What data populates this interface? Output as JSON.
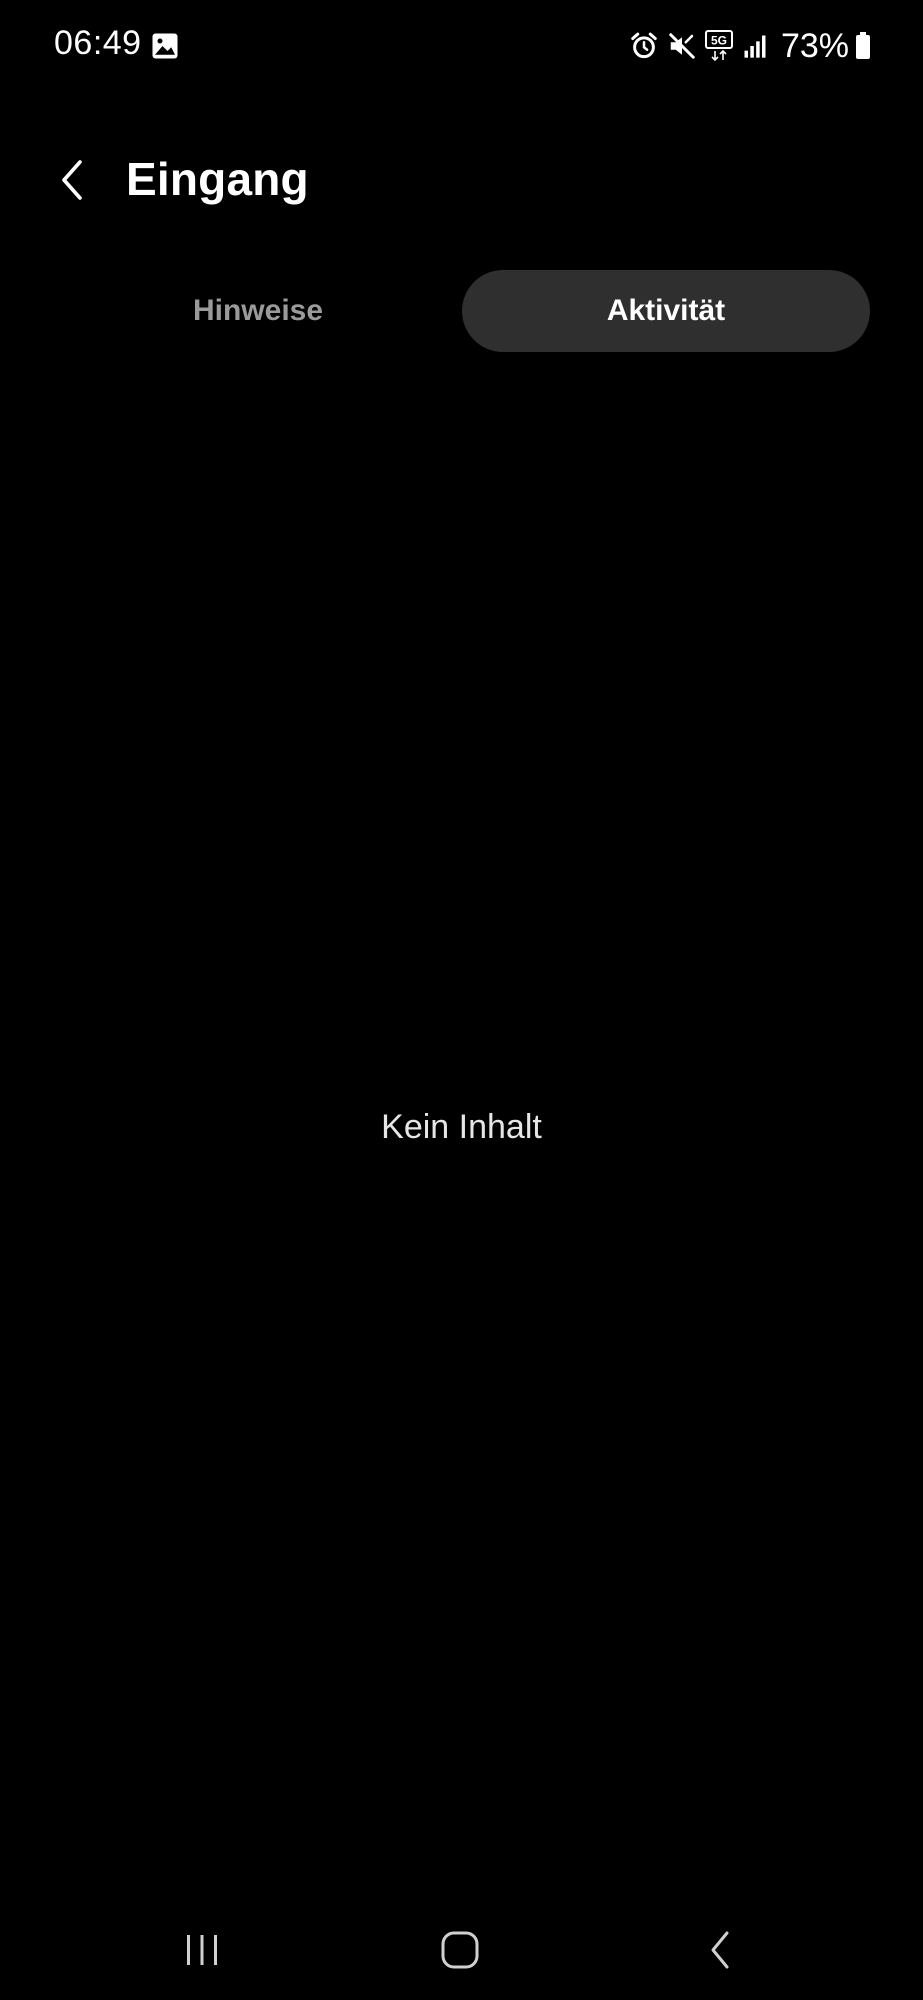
{
  "status_bar": {
    "time": "06:49",
    "battery_percent": "73%",
    "network_type": "5G",
    "icons": [
      "gallery-icon",
      "alarm-icon",
      "mute-icon",
      "5g-icon",
      "signal-icon",
      "battery-icon"
    ]
  },
  "header": {
    "title": "Eingang",
    "back_icon": "chevron-left-icon"
  },
  "tabs": [
    {
      "label": "Hinweise",
      "selected": false
    },
    {
      "label": "Aktivität",
      "selected": true
    }
  ],
  "main": {
    "empty_message": "Kein Inhalt"
  },
  "nav_bar": {
    "items": [
      "recents-icon",
      "home-icon",
      "back-icon"
    ]
  },
  "colors": {
    "background": "#000000",
    "tab_selected_bg": "#2f2f2f",
    "tab_unselected_text": "#9a9a9a",
    "text_primary": "#ffffff"
  }
}
